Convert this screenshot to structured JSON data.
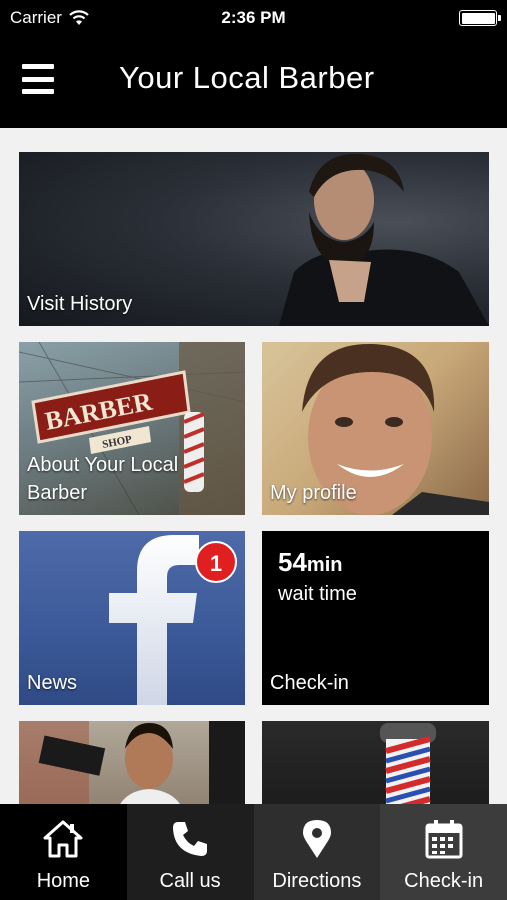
{
  "status_bar": {
    "carrier": "Carrier",
    "time": "2:36 PM",
    "battery_level": 1.0
  },
  "navbar": {
    "title": "Your Local Barber",
    "menu_icon": "hamburger-menu-icon"
  },
  "tiles": {
    "history": {
      "label": "Visit History"
    },
    "about": {
      "label_line1": "About Your Local",
      "label_line2": "Barber",
      "sign_text": "BARBER",
      "sign_subtext": "SHOP"
    },
    "profile": {
      "label": "My profile"
    },
    "news": {
      "label": "News",
      "badge": "1"
    },
    "checkin": {
      "wait_number": "54",
      "wait_unit": "min",
      "wait_label": "wait time",
      "label": "Check-in"
    }
  },
  "tabbar": {
    "tabs": [
      {
        "label": "Home",
        "icon": "home-icon"
      },
      {
        "label": "Call us",
        "icon": "phone-icon"
      },
      {
        "label": "Directions",
        "icon": "map-pin-icon"
      },
      {
        "label": "Check-in",
        "icon": "calendar-icon"
      }
    ]
  }
}
